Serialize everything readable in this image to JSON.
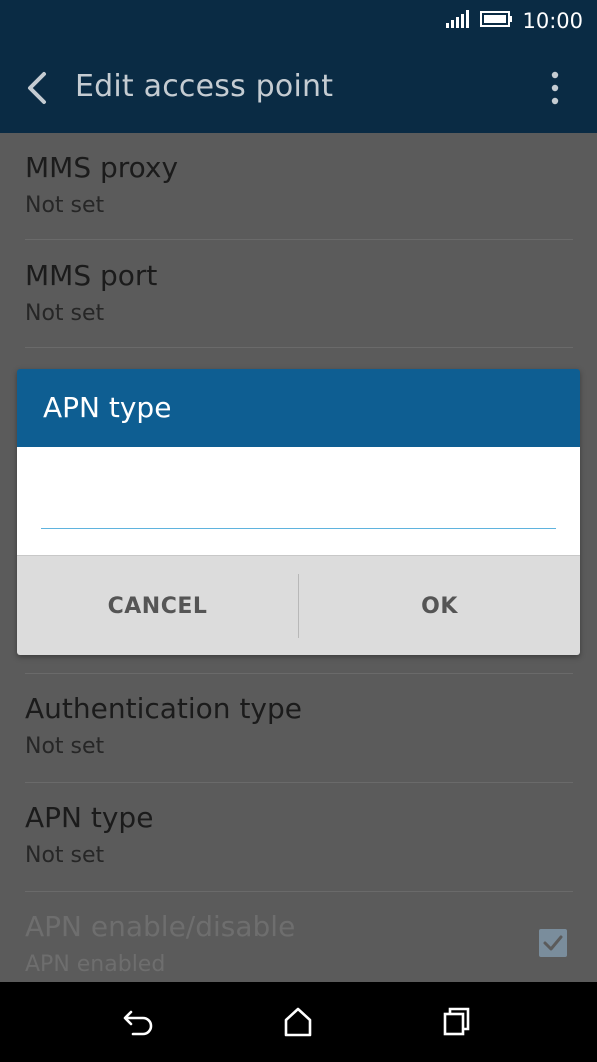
{
  "status_bar": {
    "time": "10:00"
  },
  "app_bar": {
    "title": "Edit access point"
  },
  "list": {
    "rows": [
      {
        "title": "MMS proxy",
        "value": "Not set"
      },
      {
        "title": "MMS port",
        "value": "Not set"
      },
      {
        "title": "Authentication type",
        "value": "Not set"
      },
      {
        "title": "APN type",
        "value": "Not set"
      },
      {
        "title": "APN enable/disable",
        "value": "APN enabled",
        "checked": true,
        "disabled": true
      }
    ]
  },
  "dialog": {
    "title": "APN type",
    "input_value": "",
    "cancel_label": "CANCEL",
    "ok_label": "OK"
  },
  "colors": {
    "app_bar": "#0a2b44",
    "dialog_header": "#0e5e92",
    "input_underline": "#5fb3de",
    "scrim": "#5b5b5b"
  }
}
